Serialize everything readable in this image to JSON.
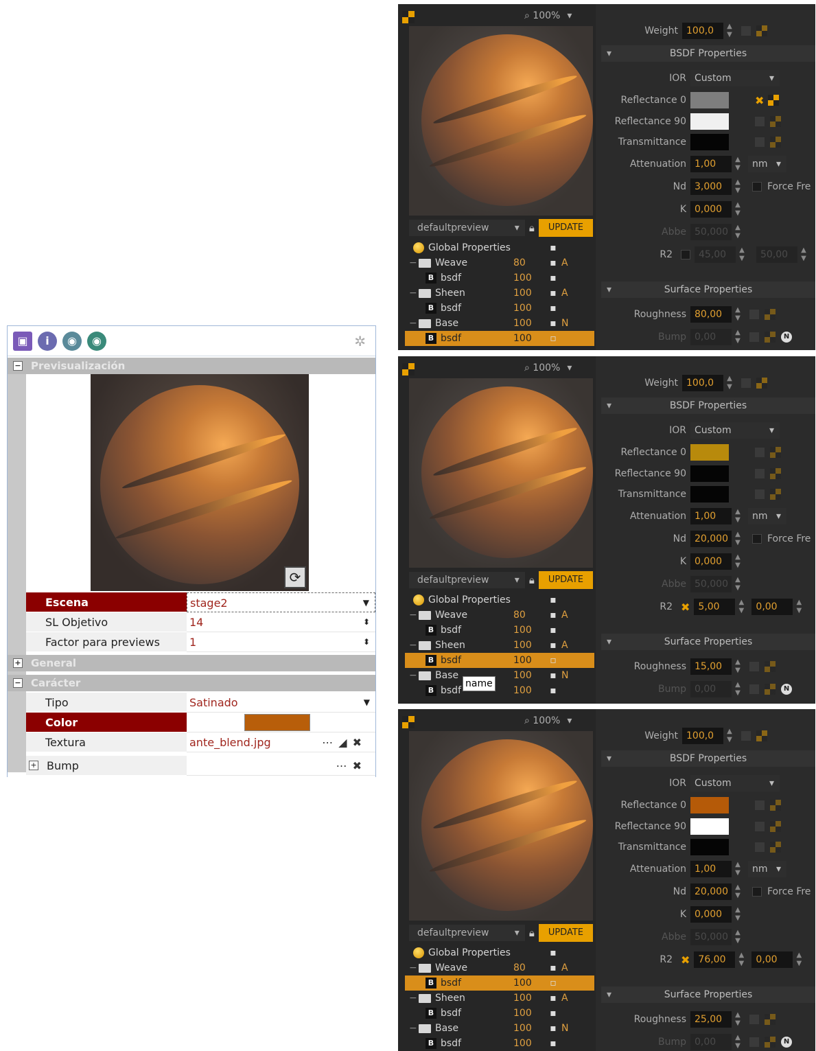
{
  "left_panel": {
    "sections": {
      "preview": "Previsualización",
      "general": "General",
      "character": "Carácter"
    },
    "rows": [
      {
        "key": "Escena",
        "value": "stage2",
        "selected": true
      },
      {
        "key": "SL Objetivo",
        "value": "14"
      },
      {
        "key": "Factor para previews",
        "value": "1"
      }
    ],
    "char_rows": [
      {
        "key": "Tipo",
        "value": "Satinado"
      },
      {
        "key": "Color",
        "value": ""
      },
      {
        "key": "Textura",
        "value": "ante_blend.jpg"
      },
      {
        "key": "Bump",
        "value": ""
      }
    ],
    "color_swatch": "#b85e0a"
  },
  "panels": [
    {
      "zoom": "100%",
      "preset": "defaultpreview",
      "update": "UPDATE",
      "tree": [
        {
          "label": "Global Properties",
          "num": "",
          "flag": ""
        },
        {
          "label": "Weave",
          "num": "80",
          "flag": "A"
        },
        {
          "label": "bsdf",
          "num": "100",
          "flag": ""
        },
        {
          "label": "Sheen",
          "num": "100",
          "flag": "A"
        },
        {
          "label": "bsdf",
          "num": "100",
          "flag": ""
        },
        {
          "label": "Base",
          "num": "100",
          "flag": "N"
        },
        {
          "label": "bsdf",
          "num": "100",
          "flag": ""
        }
      ],
      "selected_row": 6,
      "weight": "100,0",
      "bsdf_header": "BSDF Properties",
      "ior_label": "IOR",
      "ior": "Custom",
      "refl0_label": "Reflectance 0",
      "refl0": "#7e7e7e",
      "refl90_label": "Reflectance 90",
      "refl90": "#f0f0f0",
      "trans_label": "Transmittance",
      "trans": "#050505",
      "att_label": "Attenuation",
      "att": "1,00",
      "unit": "nm",
      "nd_label": "Nd",
      "nd": "3,000",
      "force": "Force Fre",
      "k_label": "K",
      "k": "0,000",
      "abbe_label": "Abbe",
      "abbe": "50,000",
      "r2_label": "R2",
      "r2a": "45,00",
      "r2b": "50,00",
      "surface_header": "Surface Properties",
      "rough_label": "Roughness",
      "rough": "80,00",
      "bump_label": "Bump",
      "bump": "0,00",
      "weight_label": "Weight"
    },
    {
      "zoom": "100%",
      "preset": "defaultpreview",
      "update": "UPDATE",
      "tree": [
        {
          "label": "Global Properties",
          "num": "",
          "flag": ""
        },
        {
          "label": "Weave",
          "num": "80",
          "flag": "A"
        },
        {
          "label": "bsdf",
          "num": "100",
          "flag": ""
        },
        {
          "label": "Sheen",
          "num": "100",
          "flag": "A"
        },
        {
          "label": "bsdf",
          "num": "100",
          "flag": ""
        },
        {
          "label": "Base",
          "num": "100",
          "flag": "N"
        },
        {
          "label": "bsdf",
          "num": "100",
          "flag": ""
        }
      ],
      "selected_row": 4,
      "tooltip": "name",
      "weight": "100,0",
      "bsdf_header": "BSDF Properties",
      "ior_label": "IOR",
      "ior": "Custom",
      "refl0_label": "Reflectance 0",
      "refl0": "#b88a0c",
      "refl90_label": "Reflectance 90",
      "refl90": "#050505",
      "trans_label": "Transmittance",
      "trans": "#050505",
      "att_label": "Attenuation",
      "att": "1,00",
      "unit": "nm",
      "nd_label": "Nd",
      "nd": "20,000",
      "force": "Force Fre",
      "k_label": "K",
      "k": "0,000",
      "abbe_label": "Abbe",
      "abbe": "50,000",
      "r2_label": "R2",
      "r2a": "5,00",
      "r2b": "0,00",
      "surface_header": "Surface Properties",
      "rough_label": "Roughness",
      "rough": "15,00",
      "bump_label": "Bump",
      "bump": "0,00",
      "weight_label": "Weight"
    },
    {
      "zoom": "100%",
      "preset": "defaultpreview",
      "update": "UPDATE",
      "tree": [
        {
          "label": "Global Properties",
          "num": "",
          "flag": ""
        },
        {
          "label": "Weave",
          "num": "80",
          "flag": "A"
        },
        {
          "label": "bsdf",
          "num": "100",
          "flag": ""
        },
        {
          "label": "Sheen",
          "num": "100",
          "flag": "A"
        },
        {
          "label": "bsdf",
          "num": "100",
          "flag": ""
        },
        {
          "label": "Base",
          "num": "100",
          "flag": "N"
        },
        {
          "label": "bsdf",
          "num": "100",
          "flag": ""
        }
      ],
      "selected_row": 2,
      "weight": "100,0",
      "bsdf_header": "BSDF Properties",
      "ior_label": "IOR",
      "ior": "Custom",
      "refl0_label": "Reflectance 0",
      "refl0": "#b55a08",
      "refl90_label": "Reflectance 90",
      "refl90": "#ffffff",
      "trans_label": "Transmittance",
      "trans": "#050505",
      "att_label": "Attenuation",
      "att": "1,00",
      "unit": "nm",
      "nd_label": "Nd",
      "nd": "20,000",
      "force": "Force Fre",
      "k_label": "K",
      "k": "0,000",
      "abbe_label": "Abbe",
      "abbe": "50,000",
      "r2_label": "R2",
      "r2a": "76,00",
      "r2b": "0,00",
      "surface_header": "Surface Properties",
      "rough_label": "Roughness",
      "rough": "25,00",
      "bump_label": "Bump",
      "bump": "0,00",
      "weight_label": "Weight"
    }
  ]
}
